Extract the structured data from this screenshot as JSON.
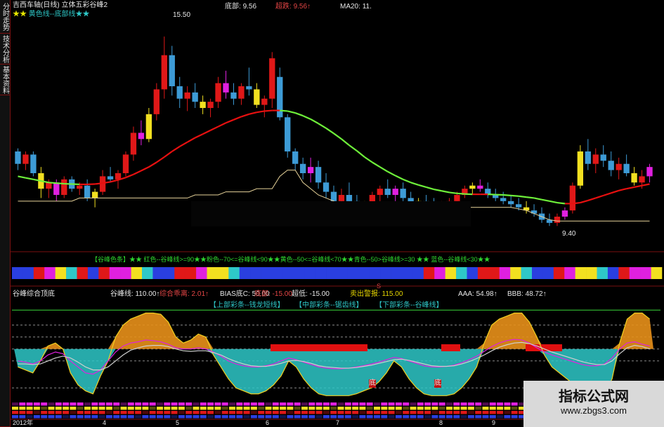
{
  "left_tabs": [
    "分时走势",
    "技术分析",
    "基本资料"
  ],
  "main_chart": {
    "title": "吉西车轴(日线) 立体五彩谷峰2",
    "legend_text": "黄色线--底部线★★",
    "header_fields": [
      {
        "label": "底部:",
        "value": "9.56"
      },
      {
        "label": "超跌:",
        "value": "9.56↑"
      },
      {
        "label": "MA20:",
        "value": "11."
      }
    ],
    "max_label": "15.50",
    "min_label": "9.40",
    "ylim": [
      9.0,
      16.0
    ]
  },
  "band_caption": "【谷峰色条】★★ 红色--谷峰线>=90★★粉色--70<=谷峰线<90★★黄色--50<=谷峰线<70★★青色--50>谷峰线>=30 ★★ 蓝色--谷峰线<30★★",
  "indicator": {
    "name": "谷峰综合顶底",
    "fields": [
      {
        "label": "谷峰线:",
        "value": "110.00↑",
        "color": "#e6e6e6"
      },
      {
        "label": "综合乖离:",
        "value": "2.01↑",
        "color": "#e34545"
      },
      {
        "label": "BIAS底C:",
        "value": "50.00",
        "color": "#e6e6e6"
      },
      {
        "label": "底部:",
        "value": "-15.00",
        "color": "#e34545"
      },
      {
        "label": "超低:",
        "value": "-15.00",
        "color": "#e6e6e6"
      },
      {
        "label": "卖出警报:",
        "value": "115.00",
        "color": "#e6d600"
      },
      {
        "label": "AAA:",
        "value": "54.98↑",
        "color": "#e6e6e6"
      },
      {
        "label": "BBB:",
        "value": "48.72↑",
        "color": "#e6e6e6"
      }
    ],
    "sub_labels": [
      "【上部彩条--钱龙短线】",
      "【中部彩条--锯齿线】",
      "【下部彩条--谷峰线】"
    ],
    "bottom_marks": [
      "底",
      "底"
    ],
    "axis_year": "2012年",
    "axis_ticks": [
      "4",
      "5",
      "6",
      "7",
      "8",
      "9"
    ],
    "marker_s": "S"
  },
  "watermark": {
    "title": "指标公式网",
    "url": "www.zbgs3.com"
  },
  "colors": {
    "up": "#e01818",
    "down": "#3d9bd6",
    "yellow": "#f2e020",
    "magenta": "#e020e0",
    "ma_red": "#e81010",
    "ma_green": "#6ef03a",
    "floor": "#e8d49a",
    "orange": "#e8901a",
    "cyan": "#2ec8c8",
    "border": "#7a1010"
  },
  "chart_data": [
    {
      "type": "candlestick",
      "series_names": [
        "MA20",
        "底部"
      ],
      "ohlc": [
        [
          11.8,
          11.9,
          11.2,
          11.4
        ],
        [
          11.4,
          11.8,
          11.2,
          11.7
        ],
        [
          11.7,
          11.8,
          11.0,
          11.1
        ],
        [
          11.1,
          11.3,
          10.3,
          10.6
        ],
        [
          10.6,
          10.9,
          10.3,
          10.8
        ],
        [
          10.8,
          10.9,
          10.2,
          10.4
        ],
        [
          10.4,
          11.0,
          10.3,
          10.9
        ],
        [
          10.9,
          11.0,
          10.5,
          10.6
        ],
        [
          10.6,
          10.8,
          10.4,
          10.7
        ],
        [
          10.7,
          10.9,
          10.2,
          10.3
        ],
        [
          10.3,
          10.6,
          10.0,
          10.5
        ],
        [
          10.5,
          11.2,
          10.4,
          11.0
        ],
        [
          11.0,
          11.3,
          10.8,
          10.9
        ],
        [
          10.9,
          11.2,
          10.6,
          11.1
        ],
        [
          11.1,
          11.8,
          11.0,
          11.7
        ],
        [
          11.7,
          12.6,
          11.5,
          12.4
        ],
        [
          12.4,
          12.8,
          12.0,
          12.2
        ],
        [
          12.2,
          13.2,
          12.1,
          13.0
        ],
        [
          13.0,
          14.0,
          12.8,
          13.8
        ],
        [
          13.8,
          15.5,
          13.5,
          14.9
        ],
        [
          14.9,
          15.2,
          13.6,
          13.9
        ],
        [
          13.9,
          14.2,
          13.2,
          13.5
        ],
        [
          13.5,
          13.9,
          13.1,
          13.7
        ],
        [
          13.7,
          14.0,
          13.2,
          13.4
        ],
        [
          13.4,
          13.6,
          13.0,
          13.2
        ],
        [
          13.2,
          13.5,
          12.9,
          13.4
        ],
        [
          13.4,
          14.2,
          13.2,
          14.0
        ],
        [
          14.0,
          14.4,
          13.5,
          13.7
        ],
        [
          13.7,
          14.0,
          13.3,
          13.5
        ],
        [
          13.5,
          14.0,
          13.3,
          13.9
        ],
        [
          13.9,
          14.5,
          13.6,
          13.8
        ],
        [
          13.8,
          14.0,
          13.2,
          13.3
        ],
        [
          13.3,
          13.6,
          12.9,
          13.5
        ],
        [
          13.5,
          15.0,
          13.2,
          14.8
        ],
        [
          14.2,
          14.5,
          12.8,
          12.9
        ],
        [
          12.9,
          13.0,
          11.6,
          11.8
        ],
        [
          11.8,
          11.9,
          11.2,
          11.4
        ],
        [
          11.4,
          11.6,
          10.9,
          11.1
        ],
        [
          11.1,
          11.6,
          10.8,
          11.3
        ],
        [
          11.3,
          11.5,
          10.6,
          10.8
        ],
        [
          10.8,
          11.1,
          10.3,
          10.5
        ],
        [
          10.5,
          10.7,
          10.0,
          10.2
        ],
        [
          10.2,
          10.6,
          9.9,
          10.4
        ],
        [
          10.4,
          10.8,
          10.1,
          10.2
        ],
        [
          10.2,
          10.4,
          9.9,
          10.0
        ],
        [
          10.0,
          10.2,
          9.9,
          10.1
        ],
        [
          10.1,
          10.5,
          10.0,
          10.4
        ],
        [
          10.4,
          10.7,
          10.2,
          10.6
        ],
        [
          10.6,
          10.9,
          10.3,
          10.4
        ],
        [
          10.4,
          10.7,
          10.2,
          10.6
        ],
        [
          10.6,
          10.8,
          10.2,
          10.3
        ],
        [
          10.3,
          10.5,
          10.0,
          10.1
        ],
        [
          10.1,
          10.3,
          9.95,
          10.2
        ],
        [
          10.2,
          10.4,
          10.0,
          10.1
        ],
        [
          10.1,
          10.3,
          9.9,
          10.0
        ],
        [
          10.0,
          10.2,
          9.9,
          10.1
        ],
        [
          10.1,
          10.3,
          10.0,
          10.2
        ],
        [
          10.2,
          10.5,
          10.1,
          10.4
        ],
        [
          10.4,
          10.7,
          10.3,
          10.6
        ],
        [
          10.6,
          10.8,
          10.4,
          10.7
        ],
        [
          10.7,
          10.9,
          10.5,
          10.6
        ],
        [
          10.6,
          10.8,
          10.3,
          10.4
        ],
        [
          10.4,
          10.6,
          10.2,
          10.3
        ],
        [
          10.3,
          10.5,
          10.1,
          10.2
        ],
        [
          10.2,
          10.4,
          10.0,
          10.1
        ],
        [
          10.1,
          10.3,
          9.9,
          10.0
        ],
        [
          10.0,
          10.2,
          9.8,
          9.9
        ],
        [
          9.9,
          10.1,
          9.7,
          9.8
        ],
        [
          9.8,
          10.0,
          9.5,
          9.6
        ],
        [
          9.6,
          9.8,
          9.4,
          9.5
        ],
        [
          9.5,
          9.8,
          9.4,
          9.7
        ],
        [
          9.7,
          10.0,
          9.6,
          9.9
        ],
        [
          9.9,
          10.8,
          9.8,
          10.7
        ],
        [
          10.7,
          12.0,
          10.6,
          11.8
        ],
        [
          11.8,
          12.2,
          11.2,
          11.4
        ],
        [
          11.4,
          11.9,
          11.1,
          11.7
        ],
        [
          11.7,
          12.0,
          11.3,
          11.5
        ],
        [
          11.5,
          11.8,
          11.0,
          11.2
        ],
        [
          11.2,
          11.6,
          10.9,
          11.4
        ],
        [
          11.4,
          11.7,
          11.0,
          11.1
        ],
        [
          11.1,
          11.3,
          10.7,
          10.8
        ],
        [
          10.8,
          11.2,
          10.6,
          11.0
        ],
        [
          11.0,
          11.4,
          10.8,
          11.3
        ]
      ],
      "ma20": [
        11.0,
        10.95,
        10.9,
        10.85,
        10.8,
        10.78,
        10.76,
        10.75,
        10.74,
        10.74,
        10.75,
        10.78,
        10.82,
        10.88,
        10.96,
        11.06,
        11.18,
        11.3,
        11.45,
        11.62,
        11.8,
        11.96,
        12.1,
        12.24,
        12.36,
        12.48,
        12.6,
        12.72,
        12.82,
        12.92,
        13.0,
        13.06,
        13.1,
        13.12,
        13.12,
        13.1,
        13.04,
        12.95,
        12.84,
        12.7,
        12.55,
        12.38,
        12.2,
        12.0,
        11.82,
        11.62,
        11.45,
        11.3,
        11.15,
        11.02,
        10.9,
        10.8,
        10.72,
        10.65,
        10.58,
        10.53,
        10.48,
        10.45,
        10.43,
        10.42,
        10.42,
        10.42,
        10.41,
        10.4,
        10.38,
        10.36,
        10.33,
        10.3,
        10.25,
        10.2,
        10.15,
        10.12,
        10.12,
        10.15,
        10.22,
        10.3,
        10.38,
        10.46,
        10.54,
        10.6,
        10.65,
        10.7,
        10.75
      ],
      "floor": [
        10.2,
        10.2,
        10.2,
        10.2,
        10.2,
        10.2,
        10.2,
        10.2,
        10.3,
        10.3,
        10.3,
        10.3,
        10.3,
        10.3,
        10.3,
        10.3,
        10.3,
        10.3,
        10.3,
        10.3,
        10.3,
        10.3,
        10.3,
        10.4,
        10.4,
        10.4,
        10.4,
        10.5,
        10.5,
        10.5,
        10.5,
        10.6,
        10.6,
        10.6,
        11.0,
        11.2,
        11.2,
        10.8,
        10.6,
        10.4,
        10.3,
        10.2,
        10.1,
        10.1,
        10.0,
        10.0,
        10.0,
        10.0,
        10.0,
        10.0,
        10.0,
        10.0,
        10.0,
        10.0,
        10.0,
        10.0,
        10.0,
        10.0,
        10.0,
        10.0,
        10.0,
        10.0,
        10.0,
        10.0,
        10.0,
        9.95,
        9.9,
        9.8,
        9.7,
        9.6,
        9.56,
        9.56,
        9.56,
        9.56,
        9.56,
        9.56,
        9.56,
        9.56,
        9.56,
        9.56,
        9.56,
        9.56,
        9.56
      ]
    },
    {
      "type": "area",
      "series_names": [
        "谷峰线",
        "AAA",
        "BBB"
      ],
      "ylim": [
        -30,
        120
      ],
      "levels": [
        115,
        90,
        70,
        50,
        30,
        -15
      ],
      "peak": [
        20,
        15,
        10,
        30,
        55,
        60,
        50,
        10,
        -10,
        -20,
        -25,
        5,
        30,
        70,
        90,
        100,
        105,
        110,
        110,
        108,
        95,
        70,
        60,
        65,
        75,
        70,
        40,
        20,
        0,
        -15,
        -20,
        -25,
        -25,
        -20,
        -10,
        5,
        30,
        20,
        0,
        -15,
        -25,
        -28,
        -28,
        -28,
        -28,
        -25,
        -20,
        -15,
        -5,
        10,
        30,
        20,
        0,
        -15,
        -25,
        -28,
        -28,
        -28,
        -25,
        -15,
        0,
        20,
        60,
        90,
        100,
        105,
        110,
        110,
        95,
        70,
        40,
        20,
        10,
        0,
        -10,
        -25,
        -28,
        -28,
        -25,
        0,
        60,
        100,
        110,
        110,
        100
      ],
      "aaa": [
        30,
        28,
        25,
        30,
        40,
        45,
        42,
        30,
        20,
        10,
        8,
        15,
        30,
        45,
        55,
        60,
        62,
        65,
        64,
        62,
        58,
        52,
        50,
        50,
        52,
        50,
        45,
        38,
        30,
        25,
        22,
        20,
        20,
        22,
        25,
        30,
        35,
        32,
        28,
        24,
        20,
        18,
        17,
        17,
        18,
        20,
        22,
        25,
        28,
        32,
        36,
        34,
        30,
        26,
        22,
        20,
        20,
        21,
        23,
        27,
        32,
        38,
        46,
        54,
        60,
        64,
        66,
        65,
        60,
        52,
        45,
        40,
        36,
        32,
        28,
        24,
        22,
        22,
        25,
        35,
        50,
        60,
        62,
        58,
        55
      ],
      "bbb": [
        25,
        25,
        24,
        25,
        30,
        35,
        38,
        35,
        28,
        20,
        15,
        15,
        20,
        30,
        40,
        48,
        52,
        55,
        56,
        56,
        54,
        50,
        47,
        46,
        47,
        47,
        44,
        40,
        34,
        29,
        25,
        22,
        21,
        21,
        23,
        26,
        30,
        31,
        29,
        26,
        22,
        20,
        19,
        18,
        18,
        19,
        21,
        23,
        26,
        29,
        32,
        33,
        31,
        28,
        25,
        22,
        21,
        21,
        22,
        25,
        29,
        34,
        40,
        47,
        53,
        57,
        60,
        61,
        59,
        55,
        50,
        45,
        41,
        37,
        33,
        29,
        26,
        24,
        24,
        30,
        42,
        52,
        56,
        54,
        50
      ]
    }
  ]
}
